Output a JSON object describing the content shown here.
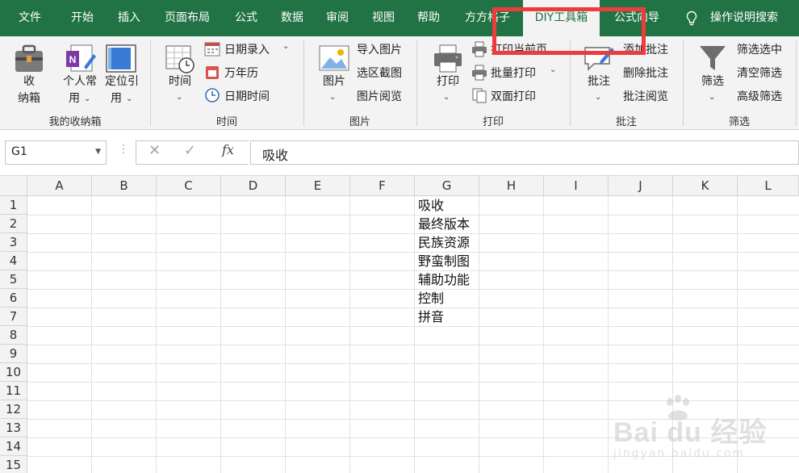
{
  "tabs": [
    {
      "label": "文件"
    },
    {
      "label": "开始"
    },
    {
      "label": "插入"
    },
    {
      "label": "页面布局"
    },
    {
      "label": "公式"
    },
    {
      "label": "数据"
    },
    {
      "label": "审阅"
    },
    {
      "label": "视图"
    },
    {
      "label": "帮助"
    },
    {
      "label": "方方格子"
    },
    {
      "label": "DIY工具箱"
    },
    {
      "label": "公式向导"
    }
  ],
  "active_tab": "DIY工具箱",
  "tell_me": "操作说明搜索",
  "ribbon": {
    "group_storage": {
      "label": "我的收纳箱",
      "btn_storage": [
        "收",
        "纳箱"
      ],
      "btn_personal": [
        "个人常",
        "用"
      ],
      "btn_locate": [
        "定位引",
        "用"
      ]
    },
    "group_time": {
      "label": "时间",
      "btn_time": "时间",
      "items": [
        "日期录入",
        "万年历",
        "日期时间"
      ]
    },
    "group_image": {
      "label": "图片",
      "btn_image": "图片",
      "items": [
        "导入图片",
        "选区截图",
        "图片阅览"
      ]
    },
    "group_print": {
      "label": "打印",
      "btn_print": "打印",
      "items": [
        "打印当前页",
        "批量打印",
        "双面打印"
      ]
    },
    "group_comment": {
      "label": "批注",
      "btn_comment": "批注",
      "items": [
        "添加批注",
        "删除批注",
        "批注阅览"
      ]
    },
    "group_filter": {
      "label": "筛选",
      "btn_filter": "筛选",
      "items": [
        "筛选选中",
        "清空筛选",
        "高级筛选"
      ]
    }
  },
  "formula_bar": {
    "name_box": "G1",
    "fx": "fx",
    "content": "吸收"
  },
  "columns": [
    "A",
    "B",
    "C",
    "D",
    "E",
    "F",
    "G",
    "H",
    "I",
    "J",
    "K",
    "L"
  ],
  "rows": [
    "1",
    "2",
    "3",
    "4",
    "5",
    "6",
    "7",
    "8",
    "9",
    "10",
    "11",
    "12",
    "13",
    "14",
    "15"
  ],
  "cells_G": [
    "吸收",
    "最终版本",
    "民族资源",
    "野蛮制图",
    "辅助功能",
    "控制",
    "拼音"
  ],
  "watermark": {
    "brand": "Bai du 经验",
    "url": "jingyan.baidu.com"
  },
  "colors": {
    "ribbon_green": "#217346",
    "highlight_red": "#ee3b3b"
  }
}
